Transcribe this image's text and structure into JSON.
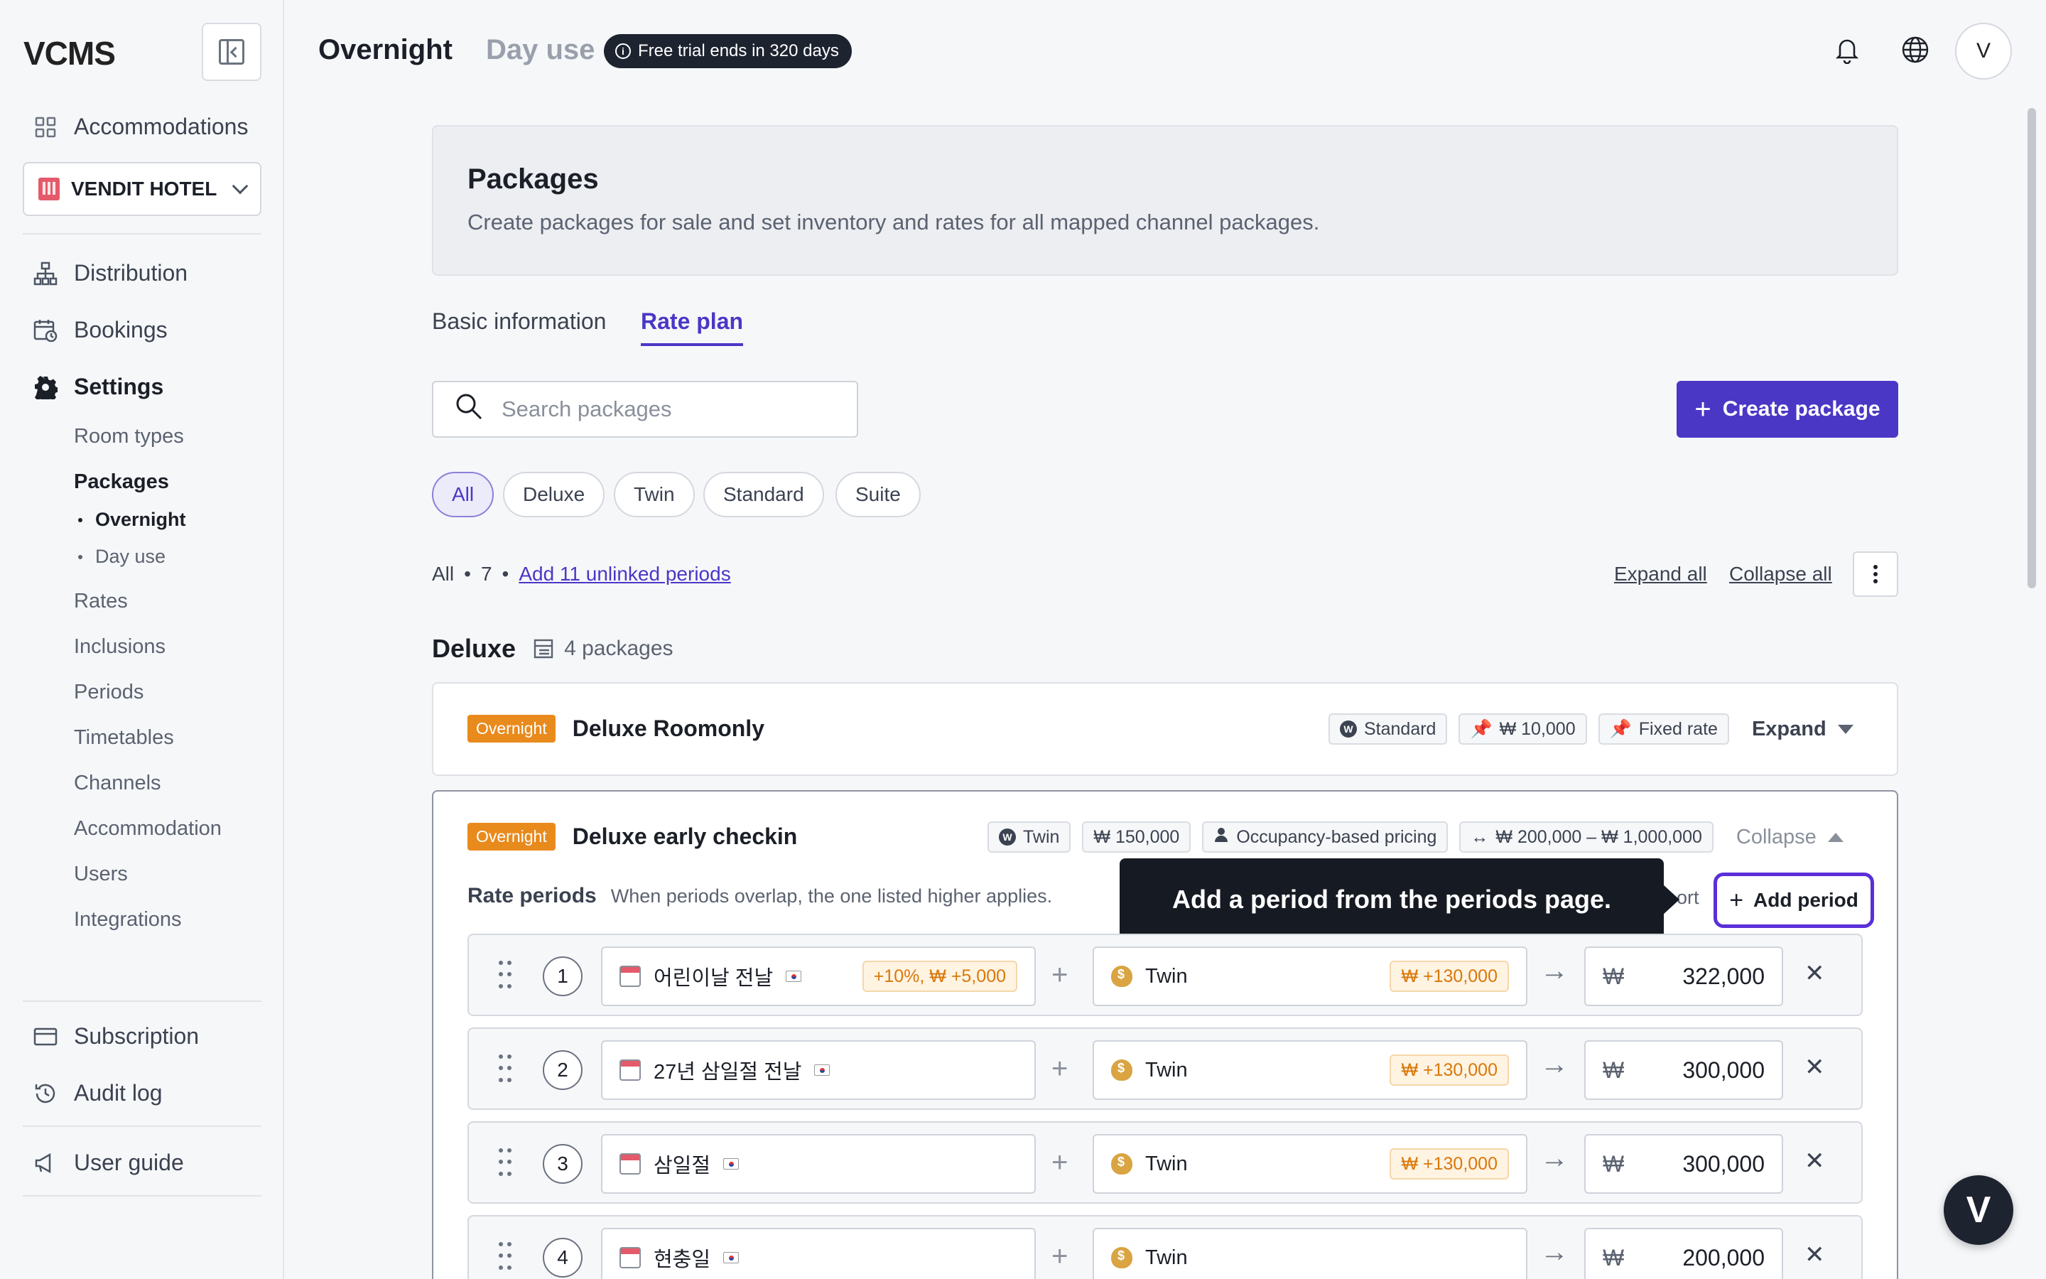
{
  "app": {
    "logo": "VCMS"
  },
  "header": {
    "tabs": [
      "Overnight",
      "Day use"
    ],
    "trial_badge": "Free trial ends in 320 days",
    "avatar": "V"
  },
  "sidebar": {
    "accommodations": "Accommodations",
    "hotel": "VENDIT HOTEL",
    "distribution": "Distribution",
    "bookings": "Bookings",
    "settings": "Settings",
    "settings_items": [
      "Room types",
      "Packages",
      "Rates",
      "Inclusions",
      "Periods",
      "Timetables",
      "Channels",
      "Accommodation",
      "Users",
      "Integrations"
    ],
    "package_sub": [
      "Overnight",
      "Day use"
    ],
    "subscription": "Subscription",
    "audit_log": "Audit log",
    "user_guide": "User guide"
  },
  "intro": {
    "title": "Packages",
    "description": "Create packages for sale and set inventory and rates for all mapped channel packages."
  },
  "tabs": [
    "Basic information",
    "Rate plan"
  ],
  "search": {
    "placeholder": "Search packages"
  },
  "create_button": "Create package",
  "filters": [
    "All",
    "Deluxe",
    "Twin",
    "Standard",
    "Suite"
  ],
  "summary": {
    "label": "All",
    "count": "7",
    "link": "Add 11 unlinked periods"
  },
  "actions": {
    "expand_all": "Expand all",
    "collapse_all": "Collapse all"
  },
  "group": {
    "name": "Deluxe",
    "count": "4 packages"
  },
  "packages": [
    {
      "badge": "Overnight",
      "name": "Deluxe Roomonly",
      "tags": [
        "Standard",
        "₩ 10,000",
        "Fixed rate"
      ],
      "toggle": "Expand"
    },
    {
      "badge": "Overnight",
      "name": "Deluxe early checkin",
      "tags": [
        "Twin",
        "₩ 150,000",
        "Occupancy-based pricing",
        "₩ 200,000 – ₩ 1,000,000"
      ],
      "toggle": "Collapse"
    }
  ],
  "rate_periods": {
    "title": "Rate periods",
    "hint": "When periods overlap, the one listed higher applies.",
    "sort_peek": "ort",
    "add_button": "Add period",
    "tooltip": "Add a period from the periods page.",
    "currency": "₩",
    "rows": [
      {
        "num": "1",
        "period": "어린이날 전날",
        "period_mod": "+10%, ₩ +5,000",
        "room": "Twin",
        "room_mod": "₩ +130,000",
        "price": "322,000"
      },
      {
        "num": "2",
        "period": "27년 삼일절 전날",
        "period_mod": "",
        "room": "Twin",
        "room_mod": "₩ +130,000",
        "price": "300,000"
      },
      {
        "num": "3",
        "period": "삼일절",
        "period_mod": "",
        "room": "Twin",
        "room_mod": "₩ +130,000",
        "price": "300,000"
      },
      {
        "num": "4",
        "period": "현충일",
        "period_mod": "",
        "room": "Twin",
        "room_mod": "",
        "price": "200,000"
      }
    ]
  },
  "colors": {
    "accent": "#4a37c6",
    "orange": "#e98a1c",
    "dark": "#1e2330"
  }
}
